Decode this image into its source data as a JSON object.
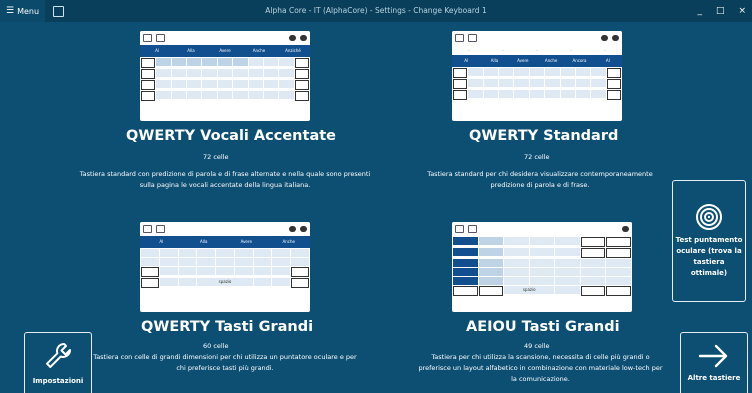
{
  "window": {
    "menu_label": "Menu",
    "title": "Alpha Core - IT (AlphaCore) - Settings - Change Keyboard 1",
    "minimize": "_",
    "maximize": "□",
    "close": "×"
  },
  "keyboards": [
    {
      "title": "QWERTY Vocali Accentate",
      "cells": "72 celle",
      "description": "Tastiera standard con predizione di parola e di frase alternate e nella quale sono presenti sulla pagina le vocali accentate della lingua italiana.",
      "predictions": [
        "Al",
        "Alla",
        "Avere",
        "Anche",
        "Anziché"
      ]
    },
    {
      "title": "QWERTY Standard",
      "cells": "72 celle",
      "description": "Tastiera standard per chi desidera visualizzare contemporaneamente predizione di parola e di frase.",
      "predictions": [
        "Al",
        "Alla",
        "Avere",
        "Anche",
        "Ancora",
        "Al"
      ]
    },
    {
      "title": "QWERTY Tasti Grandi",
      "cells": "60 celle",
      "description": "Tastiera con celle di grandi dimensioni per chi utilizza un puntatore oculare e per chi preferisce tasti più grandi.",
      "predictions": [
        "Al",
        "Alla",
        "Avere",
        "Anche"
      ],
      "space_label": "spazio"
    },
    {
      "title": "AEIOU Tasti Grandi",
      "cells": "49 celle",
      "description": "Tastiera per chi utilizza la scansione, necessita di celle più grandi o preferisce un layout alfabetico in combinazione con materiale low-tech per la comunicazione.",
      "space_label": "spazio"
    }
  ],
  "side": {
    "eye_test_label": "Test puntamento oculare (trova la tastiera ottimale)",
    "settings_label": "Impostazioni",
    "more_label": "Altre tastiere"
  },
  "colors": {
    "background": "#0d4f73",
    "titlebar": "#0a3f5c",
    "prediction_bar": "#114f8f"
  },
  "icons": [
    "menu-icon",
    "save-icon",
    "wrench-icon",
    "arrow-right-icon",
    "eye-target-icon"
  ]
}
